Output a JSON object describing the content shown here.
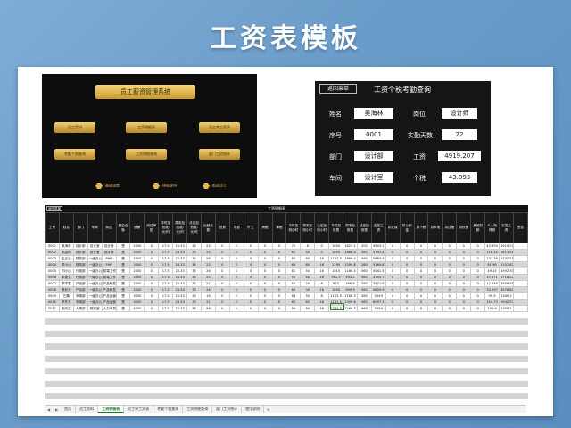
{
  "banner_title": "工资表模板",
  "dashboard": {
    "title": "员工薪资管理系统",
    "buttons": [
      "员工资料",
      "工资明细表",
      "员工单工资表",
      "考勤个税查询",
      "工资明细查询",
      "部门工资统计"
    ],
    "bottom": [
      "基础设置",
      "模板说明",
      "数据统计"
    ]
  },
  "query": {
    "back": "返回菜单",
    "title": "工资个税考勤查询",
    "name_label": "姓名",
    "name_val": "吴海林",
    "post_label": "岗位",
    "post_val": "设计师",
    "seq_label": "序号",
    "seq_val": "0001",
    "days_label": "实勤天数",
    "days_val": "22",
    "dept_label": "部门",
    "dept_val": "设计部",
    "wage_label": "工资",
    "wage_val": "4919.207",
    "group_label": "车间",
    "group_val": "设计室",
    "tax_label": "个税",
    "tax_val": "43.893"
  },
  "table": {
    "back": "返回菜单",
    "title": "工资明细表",
    "headers": [
      "工号",
      "姓名",
      "部门",
      "车间",
      "岗位",
      "是否全勤",
      "底薪",
      "岗位津贴",
      "平时加班费/元/时",
      "周末加班费/元/时",
      "法定加班费/元/时",
      "出勤天数",
      "迟到",
      "早退",
      "旷工",
      "病假",
      "事假",
      "平时加班小时",
      "周末加班小时",
      "法定加班小时",
      "平时加班费",
      "周末加班费",
      "法定加班费",
      "应发工资",
      "扣社保",
      "扣公积金",
      "扣个税",
      "扣水电",
      "扣住宿",
      "扣伙食",
      "其他扣款",
      "个人所得税",
      "实发工资",
      "签名"
    ],
    "rows": [
      [
        "0001",
        "吴海林",
        "设计部",
        "设计室",
        "设计师",
        "是",
        "2000",
        "0",
        "17.5",
        "23.33",
        "35",
        "22",
        "0",
        "0",
        "0",
        "0",
        "0",
        "70",
        "8",
        "0",
        "1050",
        "1623.1",
        "200",
        "4903.1",
        "0",
        "0",
        "0",
        "0",
        "0",
        "0",
        "0",
        "43.893",
        "4919.207",
        ""
      ],
      [
        "0002",
        "朱国尚",
        "设计部",
        "设计室",
        "设计师",
        "是",
        "2000",
        "0",
        "17.5",
        "23.33",
        "35",
        "25",
        "0",
        "0",
        "0",
        "0",
        "0",
        "62",
        "50",
        "0",
        "1050",
        "1866.4",
        "280",
        "5731.4",
        "0",
        "0",
        "0",
        "0",
        "0",
        "0",
        "0",
        "118.14",
        "5611.26",
        ""
      ],
      [
        "0003",
        "王正云",
        "财务部",
        "一级办公室",
        "PHP",
        "是",
        "2000",
        "0",
        "17.5",
        "23.33",
        "35",
        "26",
        "0",
        "0",
        "0",
        "0",
        "0",
        "65",
        "80",
        "16",
        "1137.5",
        "1866.4",
        "560",
        "5863.9",
        "0",
        "0",
        "0",
        "0",
        "0",
        "0",
        "0",
        "131.39",
        "5732.51",
        ""
      ],
      [
        "0004",
        "李小川",
        "财务部",
        "一级办公室",
        "PHP",
        "是",
        "2000",
        "0",
        "17.5",
        "23.33",
        "35",
        "22",
        "0",
        "0",
        "0",
        "0",
        "0",
        "66",
        "60",
        "16",
        "1190",
        "1399.8",
        "280",
        "5169.8",
        "0",
        "0",
        "0",
        "0",
        "0",
        "0",
        "0",
        "61.98",
        "5107.82",
        ""
      ],
      [
        "0005",
        "刘小山",
        "行政部",
        "一级办公室",
        "前端工作",
        "是",
        "2000",
        "0",
        "17.5",
        "23.33",
        "35",
        "26",
        "0",
        "0",
        "0",
        "0",
        "0",
        "61",
        "50",
        "16",
        "1015",
        "1166.5",
        "560",
        "5041.5",
        "0",
        "0",
        "0",
        "0",
        "0",
        "0",
        "0",
        "49.15",
        "4992.35",
        ""
      ],
      [
        "0006",
        "朱更生",
        "行政部",
        "一级办公室",
        "前端工作",
        "是",
        "2000",
        "0",
        "17.5",
        "23.33",
        "35",
        "25",
        "0",
        "0",
        "0",
        "0",
        "0",
        "55",
        "40",
        "16",
        "962.5",
        "933.2",
        "560",
        "4755.7",
        "0",
        "0",
        "0",
        "0",
        "0",
        "0",
        "0",
        "37.671",
        "4718.029",
        ""
      ],
      [
        "0007",
        "李学君",
        "产品部",
        "一级办公室",
        "产品研发",
        "是",
        "2000",
        "0",
        "17.5",
        "23.33",
        "35",
        "22",
        "0",
        "0",
        "0",
        "0",
        "0",
        "50",
        "20",
        "8",
        "875",
        "466.6",
        "280",
        "3921.6",
        "0",
        "0",
        "0",
        "0",
        "0",
        "0",
        "0",
        "12.648",
        "3908.952",
        ""
      ],
      [
        "0008",
        "蔡利光",
        "产品部",
        "一级办公室",
        "产品研发",
        "是",
        "2000",
        "0",
        "17.5",
        "23.33",
        "35",
        "24",
        "0",
        "0",
        "0",
        "0",
        "0",
        "60",
        "30",
        "16",
        "1050",
        "699.9",
        "560",
        "4609.9",
        "0",
        "0",
        "0",
        "0",
        "0",
        "0",
        "0",
        "33.297",
        "4576.603",
        ""
      ],
      [
        "0009",
        "乞鹏",
        "市场部",
        "一级办公室",
        "产品运营",
        "是",
        "3000",
        "0",
        "17.5",
        "23.33",
        "35",
        "19",
        "0",
        "0",
        "0",
        "0",
        "0",
        "63",
        "50",
        "8",
        "1102.5",
        "1166.5",
        "280",
        "5549",
        "0",
        "0",
        "0",
        "0",
        "0",
        "0",
        "0",
        "99.9",
        "5449.1",
        ""
      ],
      [
        "0010",
        "李东东",
        "市场部",
        "一级办公室",
        "产品运营",
        "是",
        "3000",
        "0",
        "17.5",
        "23.33",
        "35",
        "21",
        "0",
        "0",
        "0",
        "0",
        "0",
        "65",
        "60",
        "16",
        "1137.5",
        "1399.8",
        "560",
        "6097.3",
        "0",
        "0",
        "0",
        "0",
        "0",
        "0",
        "0",
        "154.73",
        "5942.57",
        ""
      ],
      [
        "0011",
        "张向吉",
        "人事部",
        "财务室",
        "人力专员",
        "是",
        "2000",
        "0",
        "17.5",
        "23.33",
        "35",
        "26",
        "0",
        "0",
        "0",
        "0",
        "0",
        "59",
        "50",
        "16",
        "1032.5",
        "1166.5",
        "560",
        "5559",
        "0",
        "0",
        "0",
        "0",
        "0",
        "0",
        "0",
        "100.9",
        "5458.1",
        ""
      ]
    ]
  },
  "tabs": [
    "首页",
    "员工资料",
    "工资明细表",
    "员工单工资表",
    "考勤个税查询",
    "工资明细查询",
    "部门工资统计",
    "使用说明"
  ],
  "active_tab": "工资明细表"
}
